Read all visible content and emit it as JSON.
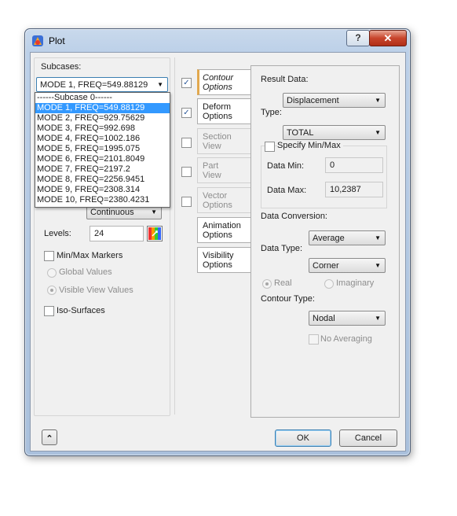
{
  "window": {
    "title": "Plot",
    "help_label": "?",
    "close_label": "✕"
  },
  "left": {
    "subcases_label": "Subcases:",
    "subcase_selected": "MODE 1, FREQ=549.88129",
    "subcase_options": [
      "------Subcase 0------",
      "MODE 1, FREQ=549.88129",
      "MODE 2, FREQ=929.75629",
      "MODE 3, FREQ=992.698",
      "MODE 4, FREQ=1002.186",
      "MODE 5, FREQ=1995.075",
      "MODE 6, FREQ=2101.8049",
      "MODE 7, FREQ=2197.2",
      "MODE 8, FREQ=2256.9451",
      "MODE 9, FREQ=2308.314",
      "MODE 10, FREQ=2380.4231"
    ],
    "highlighted_option_index": 1,
    "continuous_value": "Continuous",
    "levels_label": "Levels:",
    "levels_value": "24",
    "minmax_markers_label": "Min/Max Markers",
    "global_values_label": "Global Values",
    "visible_view_values_label": "Visible View Values",
    "iso_surfaces_label": "Iso-Surfaces"
  },
  "tabs": [
    {
      "label": "Contour Options",
      "checked": true,
      "enabled": true,
      "active": true
    },
    {
      "label": "Deform Options",
      "checked": true,
      "enabled": true,
      "active": false
    },
    {
      "label": "Section View",
      "checked": false,
      "enabled": false,
      "active": false
    },
    {
      "label": "Part View",
      "checked": false,
      "enabled": false,
      "active": false
    },
    {
      "label": "Vector Options",
      "checked": false,
      "enabled": false,
      "active": false
    },
    {
      "label": "Animation Options",
      "enabled": true,
      "active": false
    },
    {
      "label": "Visibility Options",
      "enabled": true,
      "active": false
    }
  ],
  "contour": {
    "result_data_label": "Result Data:",
    "result_data_value": "Displacement",
    "type_label": "Type:",
    "type_value": "TOTAL",
    "specify_minmax_label": "Specify Min/Max",
    "data_min_label": "Data Min:",
    "data_min_value": "0",
    "data_max_label": "Data Max:",
    "data_max_value": "10,2387",
    "data_conversion_label": "Data Conversion:",
    "data_conversion_value": "Average",
    "data_type_label": "Data Type:",
    "data_type_value": "Corner",
    "real_label": "Real",
    "imaginary_label": "Imaginary",
    "contour_type_label": "Contour Type:",
    "contour_type_value": "Nodal",
    "no_averaging_label": "No Averaging"
  },
  "footer": {
    "expand_label": "⌃",
    "ok_label": "OK",
    "cancel_label": "Cancel"
  }
}
